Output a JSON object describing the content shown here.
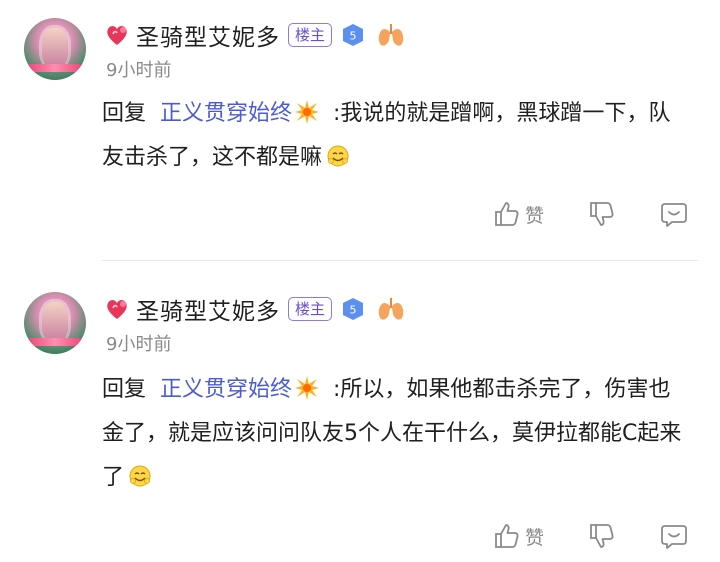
{
  "comments": [
    {
      "username": "圣骑型艾妮多",
      "owner_badge": "楼主",
      "level": "5",
      "time": "9小时前",
      "reply_word": "回复",
      "reply_target": "正义贯穿始终",
      "text": " :我说的就是蹭啊，黑球蹭一下，队友击杀了，这不都是嘛",
      "like_label": "赞"
    },
    {
      "username": "圣骑型艾妮多",
      "owner_badge": "楼主",
      "level": "5",
      "time": "9小时前",
      "reply_word": "回复",
      "reply_target": "正义贯穿始终",
      "text": " :所以，如果他都击杀完了，伤害也金了，就是应该问问队友5个人在干什么，莫伊拉都能C起来了",
      "like_label": "赞"
    }
  ],
  "colors": {
    "reply_target": "#4b5bd6",
    "owner_badge": "#6a4fd0",
    "level_badge": "#5b8ff0",
    "muted": "#8a8a8a"
  },
  "icons": [
    "heart-icon",
    "level-badge-icon",
    "lungs-icon",
    "burst-icon",
    "smile-emoji-icon",
    "thumbs-up-icon",
    "thumbs-down-icon",
    "comment-icon"
  ]
}
